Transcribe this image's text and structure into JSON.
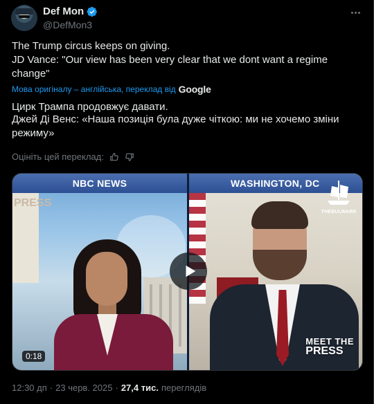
{
  "author": {
    "display_name": "Def Mon",
    "handle": "@DefMon3",
    "verified": true
  },
  "post": {
    "line1": "The Trump circus keeps on giving.",
    "line2": "JD Vance: \"Our view has been very clear that we dont want a regime change\"",
    "translation_note": "Мова оригіналу – англійська, переклад від",
    "translation_provider": "Google",
    "translated_line1": "Цирк Трампа продовжує давати.",
    "translated_line2": "Джей Ді Венс: «Наша позиція була дуже чіткою: ми не хочемо зміни режиму»",
    "rate_translation": "Оцініть цей переклад:"
  },
  "video": {
    "left_label": "NBC NEWS",
    "right_label": "WASHINGTON, DC",
    "side_sign": "PRESS",
    "watermark": "THEBULWARK",
    "show_logo_line1": "MEET THE",
    "show_logo_line2": "PRESS",
    "duration": "0:18"
  },
  "meta": {
    "time": "12:30 дп",
    "separator": "·",
    "date": "23 черв. 2025",
    "views": "27,4 тис.",
    "views_label": "переглядів"
  },
  "colors": {
    "background": "#000000",
    "text": "#e7e9ea",
    "secondary": "#71767b",
    "link": "#1d9bf0",
    "verified": "#1d9bf0"
  },
  "icons": {
    "verified": "verified-badge-icon",
    "more": "more-horizontal-icon",
    "thumbs_up": "thumbs-up-icon",
    "thumbs_down": "thumbs-down-icon",
    "play": "play-icon"
  }
}
